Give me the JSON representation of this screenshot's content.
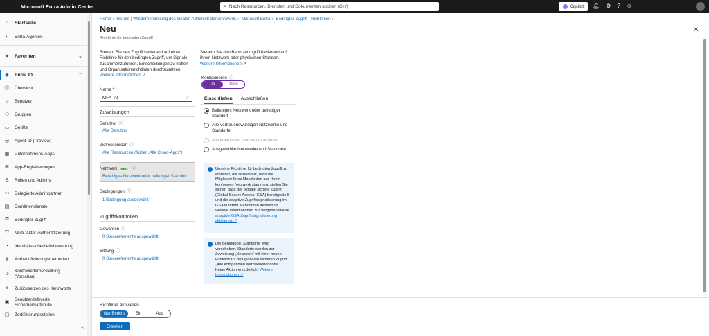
{
  "topbar": {
    "app_title": "Microsoft Entra Admin Center",
    "search_placeholder": "Nach Ressourcen, Diensten und Dokumenten suchen (G+/)",
    "copilot_label": "Copilot"
  },
  "sidebar": {
    "items": [
      {
        "label": "Startseite",
        "icon": "home-icon"
      },
      {
        "label": "Entra-Agenten",
        "icon": "agent-icon"
      },
      {
        "label": "Favoriten",
        "icon": "star-icon"
      },
      {
        "label": "Entra ID",
        "icon": "entra-icon"
      },
      {
        "label": "Übersicht",
        "icon": "info-icon"
      },
      {
        "label": "Benutzer",
        "icon": "user-icon"
      },
      {
        "label": "Gruppen",
        "icon": "group-icon"
      },
      {
        "label": "Geräte",
        "icon": "device-icon"
      },
      {
        "label": "Agent-ID (Preview)",
        "icon": "agent-id-icon"
      },
      {
        "label": "Unternehmens-Apps",
        "icon": "apps-icon"
      },
      {
        "label": "App-Registrierungen",
        "icon": "app-reg-icon"
      },
      {
        "label": "Rollen und Admins",
        "icon": "roles-icon"
      },
      {
        "label": "Delegierte Adminpartner",
        "icon": "partner-icon"
      },
      {
        "label": "Domänendienste",
        "icon": "domain-icon"
      },
      {
        "label": "Bedingter Zugriff",
        "icon": "lock-icon"
      },
      {
        "label": "Multi-faktor-Authentifizierung",
        "icon": "mfa-icon"
      },
      {
        "label": "Identitätssicherheitsbewertung",
        "icon": "score-icon"
      },
      {
        "label": "Authentifizierungsmethoden",
        "icon": "key-icon"
      },
      {
        "label": "Kontowiederherstellung (Vorschau)",
        "icon": "recovery-icon"
      },
      {
        "label": "Zurücksetzen des Kennworts",
        "icon": "password-icon"
      },
      {
        "label": "Benutzerdefinierte Sicherheitsattribute",
        "icon": "attribute-icon"
      },
      {
        "label": "Zertifizierungsstellen",
        "icon": "certificate-icon"
      }
    ]
  },
  "breadcrumb": [
    "Home",
    "Geräte | Wiederherstellung des lokalen Administratorkennworts",
    "Microsoft Entra",
    "Bedingter Zugriff | Richtlinien"
  ],
  "page": {
    "title": "Neu",
    "subtitle": "Richtlinie für bedingten Zugriff"
  },
  "left": {
    "intro": "Steuern Sie den Zugriff basierend auf einer Richtlinie für den bedingten Zugriff, um Signale zusammenzuführen, Entscheidungen zu treffen und Organisationsrichtlinien durchzusetzen.",
    "intro_link": "Weitere Informationen ↗",
    "name_label": "Name *",
    "name_value": "MFA_All",
    "assignments": "Zuweisungen",
    "users_label": "Benutzer",
    "users_value": "Alle Benutzer",
    "targets_label": "Zielressourcen",
    "targets_value": "Alle Ressourcen (früher „Alle Cloud-Apps“)",
    "network_label": "Netzwerk",
    "network_badge": "NEU",
    "network_value": "Beliebiges Netzwerk oder beliebiger Standort",
    "conditions_label": "Bedingungen",
    "conditions_value": "1 Bedingung ausgewählt",
    "access_controls": "Zugriffskontrollen",
    "grant_label": "Gewähren",
    "grant_value": "0 Steuerelemente ausgewählt",
    "session_label": "Sitzung",
    "session_value": "0 Steuerelemente ausgewählt"
  },
  "right": {
    "intro": "Steuern Sie den Benutzerzugriff basierend auf ihrem Netzwerk oder physischen Standort.",
    "intro_link": "Weitere Informationen ↗",
    "configure_label": "Konfigurieren",
    "toggle_yes": "Ja",
    "toggle_no": "Nein",
    "tab_include": "Einschließen",
    "tab_exclude": "Ausschließen",
    "options": [
      "Beliebiges Netzwerk oder beliebiger Standort",
      "Alle vertrauenswürdigen Netzwerke und Standorte",
      "Alle konformen Netzwerkstandorte",
      "Ausgewählte Netzwerke und Standorte"
    ],
    "selected_option": 0,
    "info1": "Um eine Richtlinie für bedingten Zugriff zu erstellen, die sicherstellt, dass die Mitglieder Ihres Mandanten aus Ihrem konformen Netzwerk stammen, stellen Sie sicher, dass der globale sichere Zugriff (Global Secure Access, GSA) bereitgestellt und die adaptive Zugriffssignalisierung im GSA in Ihrem Mandanten aktiviert ist. Weitere Informationen zur Vorgehensweise",
    "info1_link": "adaptive GSA-Zugriffssignalisierung aktivieren. ↗",
    "info2": "Die Bedingung „Standorte“ wird verschoben. Standorte werden zur Zuweisung „Netzwerk“ mit einer neuen Funktion für den globalen sicheren Zugriff „Alle kompatiblen Netzwerkstandorte“. Keine Aktion erforderlich.",
    "info2_link": "Weitere Informationen ↗"
  },
  "footer": {
    "enable_label": "Richtlinie aktivieren",
    "seg_report": "Nur Bericht",
    "seg_on": "Ein",
    "seg_off": "Aus",
    "create_button": "Erstellen"
  }
}
